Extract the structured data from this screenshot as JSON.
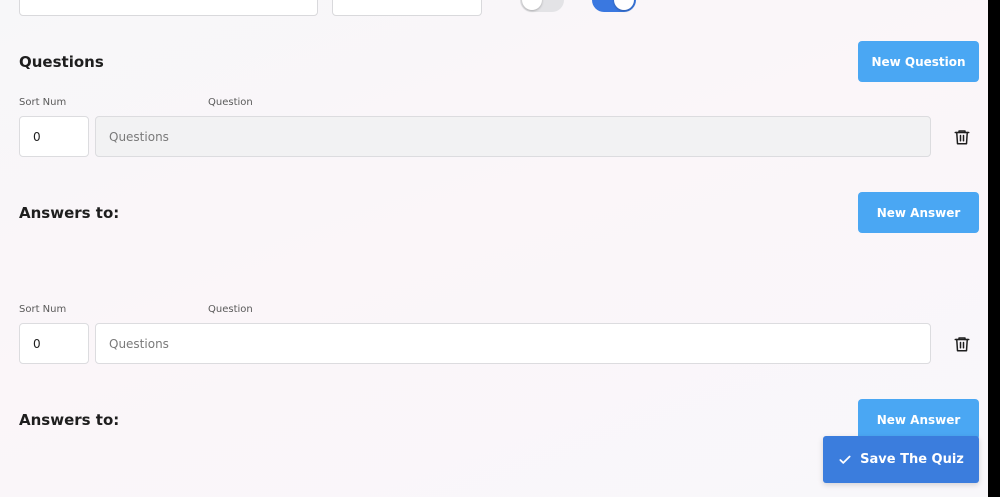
{
  "top_row": {
    "toggle_1_state": "off",
    "toggle_2_state": "on"
  },
  "questions_section": {
    "title": "Questions",
    "new_question_label": "New Question"
  },
  "question_rows": [
    {
      "sort_num_label": "Sort Num",
      "question_label": "Question",
      "sort_num_value": "0",
      "question_placeholder": "Questions",
      "answers_title": "Answers to:",
      "new_answer_label": "New Answer"
    },
    {
      "sort_num_label": "Sort Num",
      "question_label": "Question",
      "sort_num_value": "0",
      "question_placeholder": "Questions",
      "answers_title": "Answers to:",
      "new_answer_label": "New Answer"
    }
  ],
  "save_button": {
    "label": "Save The Quiz",
    "icon": "check-icon"
  },
  "colors": {
    "primary_button": "#4aa7f3",
    "save_button": "#3b7ddd",
    "toggle_on": "#3a78e0"
  }
}
